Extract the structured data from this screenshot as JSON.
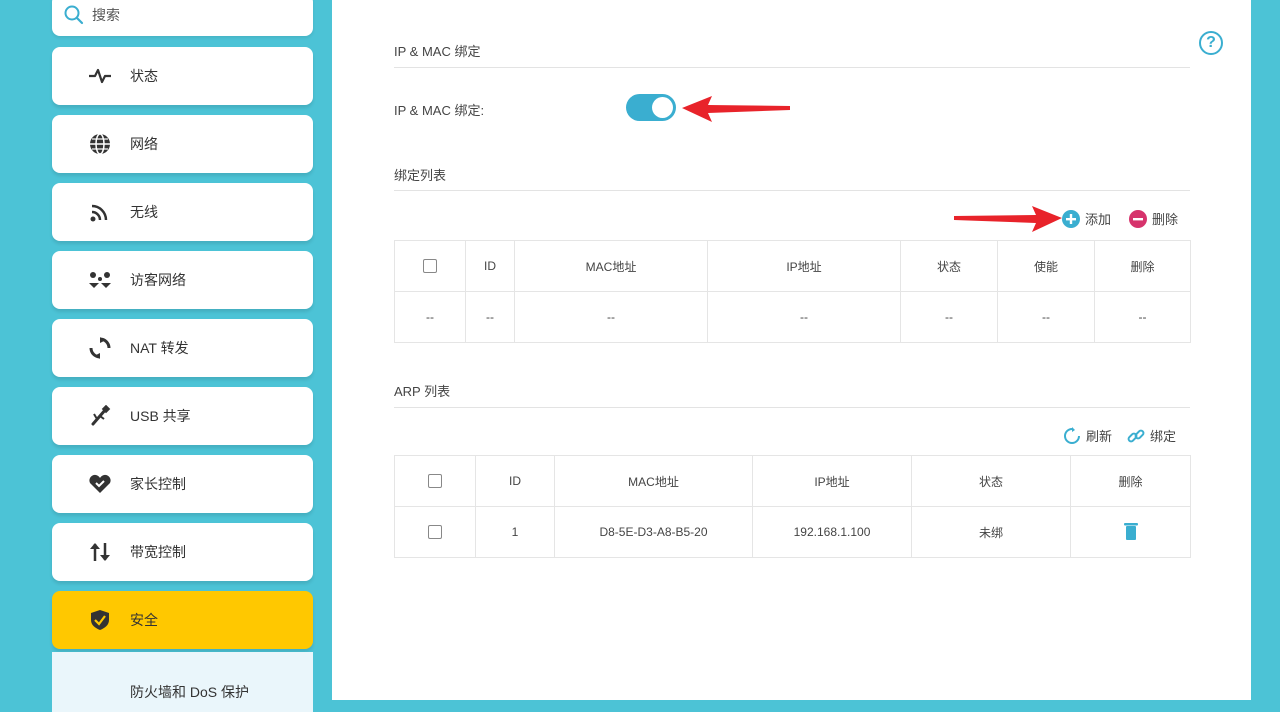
{
  "search": {
    "label": "搜索"
  },
  "sidebar": {
    "items": [
      {
        "icon": "pulse-icon",
        "label": "状态"
      },
      {
        "icon": "globe-icon",
        "label": "网络"
      },
      {
        "icon": "wifi-icon",
        "label": "无线"
      },
      {
        "icon": "guest-network-icon",
        "label": "访客网络"
      },
      {
        "icon": "nat-forward-icon",
        "label": "NAT 转发"
      },
      {
        "icon": "usb-icon",
        "label": "USB 共享"
      },
      {
        "icon": "heart-icon",
        "label": "家长控制"
      },
      {
        "icon": "bandwidth-icon",
        "label": "带宽控制"
      },
      {
        "icon": "shield-icon",
        "label": "安全",
        "active": true
      }
    ],
    "subitem": "防火墙和 DoS 保护"
  },
  "main": {
    "section1_title": "IP & MAC 绑定",
    "toggle": {
      "label": "IP & MAC 绑定:",
      "on": true
    },
    "section2_title": "绑定列表",
    "binding_actions": {
      "add": "添加",
      "delete": "删除"
    },
    "binding_table": {
      "headers": [
        "",
        "ID",
        "MAC地址",
        "IP地址",
        "状态",
        "使能",
        "删除"
      ],
      "row": [
        "--",
        "--",
        "--",
        "--",
        "--",
        "--",
        "--"
      ]
    },
    "section3_title": "ARP 列表",
    "arp_actions": {
      "refresh": "刷新",
      "bind": "绑定"
    },
    "arp_table": {
      "headers": [
        "",
        "ID",
        "MAC地址",
        "IP地址",
        "状态",
        "删除"
      ],
      "rows": [
        {
          "id": "1",
          "mac": "D8-5E-D3-A8-B5-20",
          "ip": "192.168.1.100",
          "status": "未绑"
        }
      ]
    }
  },
  "colors": {
    "accent": "#3aaed0",
    "sidebar_bg": "#4cc3d6",
    "active": "#ffc800",
    "arrow": "#e8232a",
    "delete": "#d6336c"
  }
}
